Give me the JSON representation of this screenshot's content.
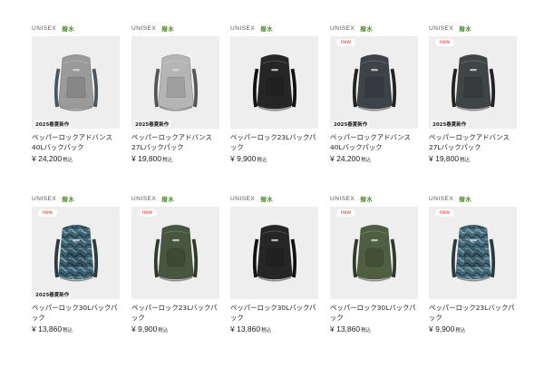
{
  "products": [
    {
      "gender": "UNISEX",
      "feature": "撥水",
      "name": "ペッパーロックアドバンス40Lバックパック",
      "price": "¥ 24,200",
      "tax": "税込",
      "new": false,
      "season": "2025春夏新作",
      "color": "#9a9a9a",
      "strap": "#4a5560",
      "style": "adv"
    },
    {
      "gender": "UNISEX",
      "feature": "撥水",
      "name": "ペッパーロックアドバンス27Lバックパック",
      "price": "¥ 19,800",
      "tax": "税込",
      "new": false,
      "season": "2025春夏新作",
      "color": "#b5b5b5",
      "strap": "#555",
      "style": "adv"
    },
    {
      "gender": "UNISEX",
      "feature": "撥水",
      "name": "ペッパーロック23Lバックパック",
      "price": "¥ 9,900",
      "tax": "税込",
      "new": false,
      "season": "",
      "color": "#262626",
      "strap": "#111",
      "style": "std"
    },
    {
      "gender": "UNISEX",
      "feature": "撥水",
      "name": "ペッパーロックアドバンス40Lバックパック",
      "price": "¥ 24,200",
      "tax": "税込",
      "new": true,
      "new_label": "new",
      "season": "2025春夏新作",
      "color": "#3e4347",
      "strap": "#222",
      "style": "adv"
    },
    {
      "gender": "UNISEX",
      "feature": "撥水",
      "name": "ペッパーロックアドバンス27Lバックパック",
      "price": "¥ 19,800",
      "tax": "税込",
      "new": true,
      "new_label": "new",
      "season": "2025春夏新作",
      "color": "#3f4446",
      "strap": "#222",
      "style": "adv"
    },
    {
      "gender": "UNISEX",
      "feature": "撥水",
      "name": "ペッパーロック30Lバックパック",
      "price": "¥ 13,860",
      "tax": "税込",
      "new": true,
      "new_label": "new",
      "season": "2025春夏新作",
      "color": "#3f6272",
      "strap": "#2b3b44",
      "style": "camo"
    },
    {
      "gender": "UNISEX",
      "feature": "撥水",
      "name": "ペッパーロック23Lバックパック",
      "price": "¥ 9,900",
      "tax": "税込",
      "new": true,
      "new_label": "new",
      "season": "",
      "color": "#48553f",
      "strap": "#2f3a2b",
      "style": "std"
    },
    {
      "gender": "UNISEX",
      "feature": "撥水",
      "name": "ペッパーロック30Lバックパック",
      "price": "¥ 13,860",
      "tax": "税込",
      "new": false,
      "season": "",
      "color": "#262626",
      "strap": "#111",
      "style": "std"
    },
    {
      "gender": "UNISEX",
      "feature": "撥水",
      "name": "ペッパーロック30Lバックパック",
      "price": "¥ 13,860",
      "tax": "税込",
      "new": true,
      "new_label": "new",
      "season": "",
      "color": "#4f5e40",
      "strap": "#2f3a2b",
      "style": "std"
    },
    {
      "gender": "UNISEX",
      "feature": "撥水",
      "name": "ペッパーロック23Lバックパック",
      "price": "¥ 9,900",
      "tax": "税込",
      "new": true,
      "new_label": "new",
      "season": "",
      "color": "#46697a",
      "strap": "#2b3b44",
      "style": "camo"
    }
  ]
}
